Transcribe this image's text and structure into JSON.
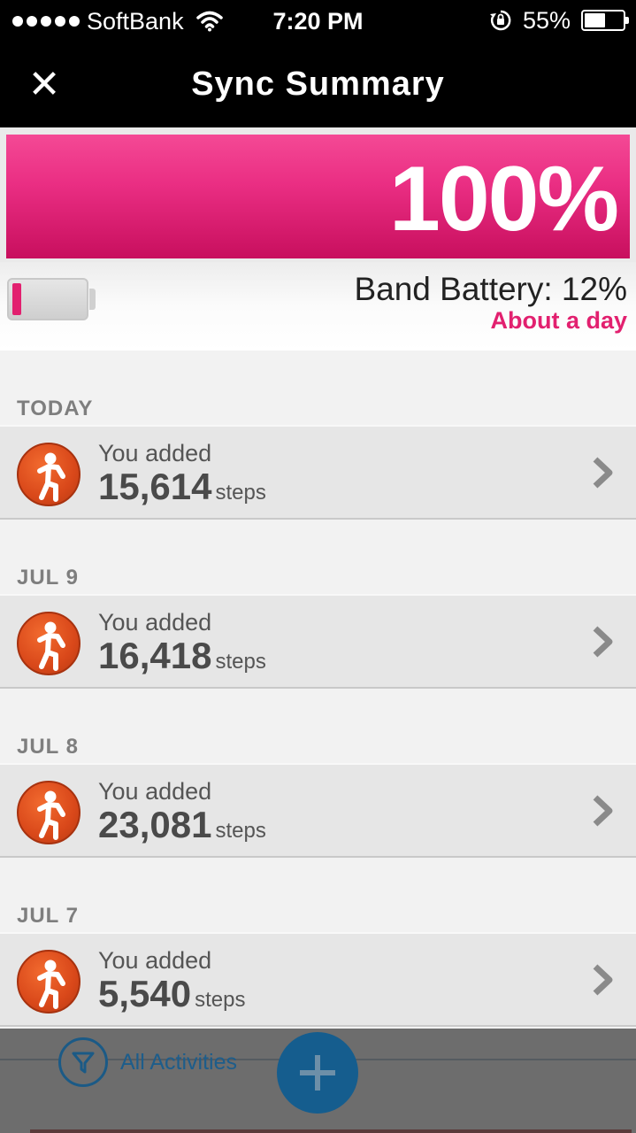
{
  "status_bar": {
    "carrier": "SoftBank",
    "time": "7:20 PM",
    "battery": "55%",
    "battery_level": 0.55,
    "icons": [
      "signal-dots-icon",
      "wifi-icon",
      "rotation-lock-icon",
      "battery-icon"
    ]
  },
  "nav": {
    "title": "Sync Summary",
    "close_icon": "close-icon"
  },
  "sync": {
    "progress_label": "100%",
    "progress_fraction": 1.0,
    "accent_color": "#e2206f"
  },
  "band": {
    "battery_label": "Band Battery: 12%",
    "battery_level": 0.12,
    "remaining": "About a day"
  },
  "activities": [
    {
      "date": "TODAY",
      "added_label": "You added",
      "value": "15,614",
      "unit": "steps",
      "icon": "walking-person-icon"
    },
    {
      "date": "JUL 9",
      "added_label": "You added",
      "value": "16,418",
      "unit": "steps",
      "icon": "walking-person-icon"
    },
    {
      "date": "JUL 8",
      "added_label": "You added",
      "value": "23,081",
      "unit": "steps",
      "icon": "walking-person-icon"
    },
    {
      "date": "JUL 7",
      "added_label": "You added",
      "value": "5,540",
      "unit": "steps",
      "icon": "walking-person-icon"
    }
  ],
  "toolbar": {
    "filter_label": "All Activities",
    "filter_icon": "filter-funnel-icon",
    "add_icon": "plus-icon"
  }
}
